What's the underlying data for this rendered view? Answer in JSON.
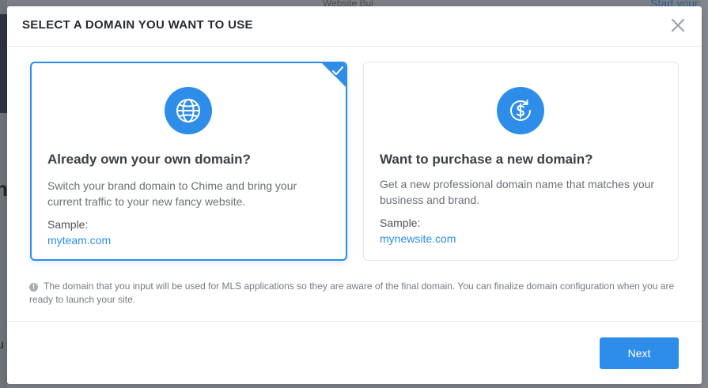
{
  "background": {
    "top_link": "Start your",
    "top_text": "Website Bui"
  },
  "modal": {
    "title": "SELECT A DOMAIN YOU WANT TO USE",
    "close_icon": "close-icon"
  },
  "options": [
    {
      "icon": "globe-icon",
      "title": "Already own your own domain?",
      "description": "Switch your brand domain to Chime and bring your current traffic to your new fancy website.",
      "sample_label": "Sample:",
      "sample_value": "myteam.com",
      "selected": true
    },
    {
      "icon": "dollar-refresh-icon",
      "title": "Want to purchase a new domain?",
      "description": "Get a new professional domain name that matches your business and brand.",
      "sample_label": "Sample:",
      "sample_value": "mynewsite.com",
      "selected": false
    }
  ],
  "note": "The domain that you input will be used for MLS applications so they are aware of the final domain. You can finalize domain configuration when you are ready to launch your site.",
  "footer": {
    "next_label": "Next"
  },
  "colors": {
    "accent": "#2e8de8",
    "title_text": "#262a33",
    "body_text": "#6b7079",
    "overlay": "#7d8087"
  }
}
